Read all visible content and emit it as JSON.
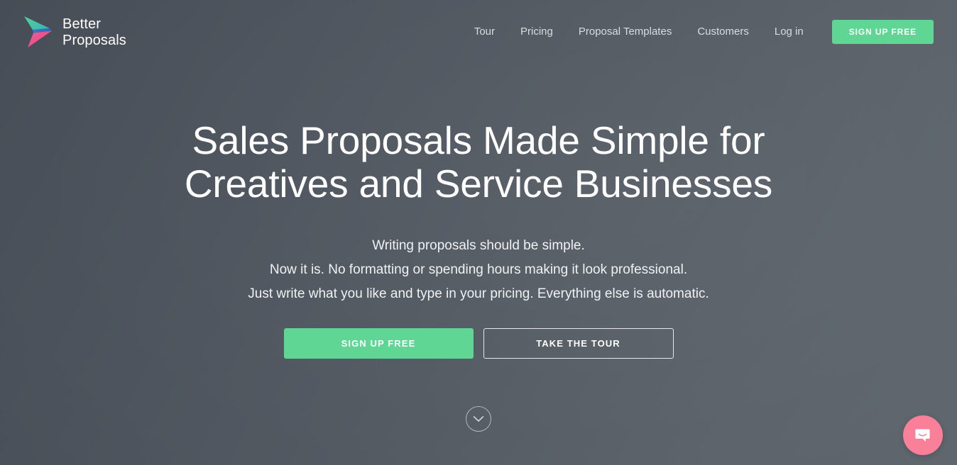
{
  "brand": {
    "name_line1": "Better",
    "name_line2": "Proposals",
    "logo_icon": "better-proposals-arrow-logo",
    "logo_colors": {
      "green": "#4FD1A0",
      "blue": "#2F6FC4",
      "pink": "#F0609B"
    }
  },
  "nav": {
    "items": [
      {
        "label": "Tour"
      },
      {
        "label": "Pricing"
      },
      {
        "label": "Proposal Templates"
      },
      {
        "label": "Customers"
      },
      {
        "label": "Log in"
      }
    ],
    "signup_label": "SIGN UP FREE"
  },
  "hero": {
    "headline": "Sales Proposals Made Simple for\nCreatives and Service Businesses",
    "subhead": "Writing proposals should be simple.\nNow it is. No formatting or spending hours making it look professional.\nJust write what you like and type in your pricing. Everything else is automatic.",
    "primary_cta": "SIGN UP FREE",
    "secondary_cta": "TAKE THE TOUR",
    "scroll_icon": "chevron-down-icon"
  },
  "chat": {
    "icon": "intercom-chat-bubble-icon",
    "color": "#F98098"
  },
  "theme": {
    "accent_green": "#5FD694",
    "background_dark": "#474E57",
    "background_light": "#5F666E",
    "text_primary": "#FFFFFF",
    "text_muted": "#D9DCDF"
  }
}
